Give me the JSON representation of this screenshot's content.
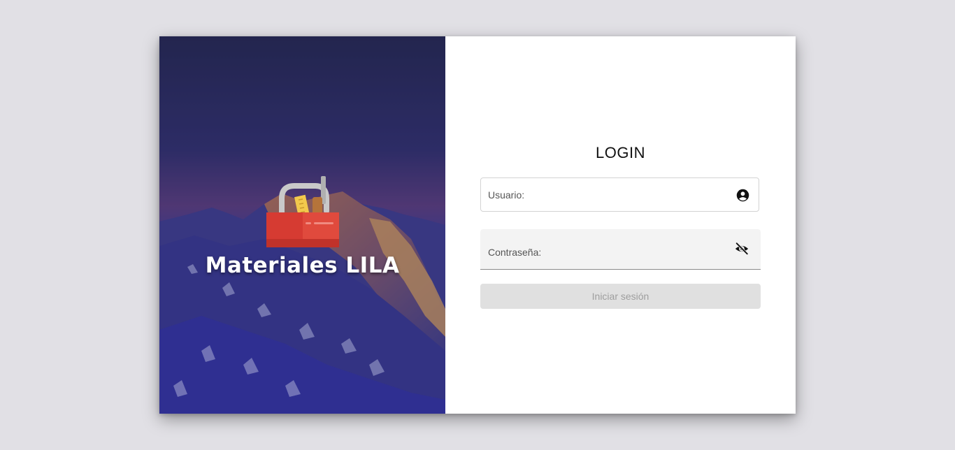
{
  "hero": {
    "brand_name": "Materiales LILA",
    "logo_icon": "toolbox-icon"
  },
  "login": {
    "title": "LOGIN",
    "username_label": "Usuario:",
    "username_icon": "account-circle-icon",
    "password_label": "Contraseña:",
    "password_icon": "visibility-off-icon",
    "submit_label": "Iniciar sesión"
  },
  "colors": {
    "page_background": "#e1e0e5",
    "card_background": "#ffffff",
    "button_disabled": "#e0e0e0",
    "button_text_disabled": "#9e9e9e",
    "hero_overlay": "#2f2f8e"
  }
}
